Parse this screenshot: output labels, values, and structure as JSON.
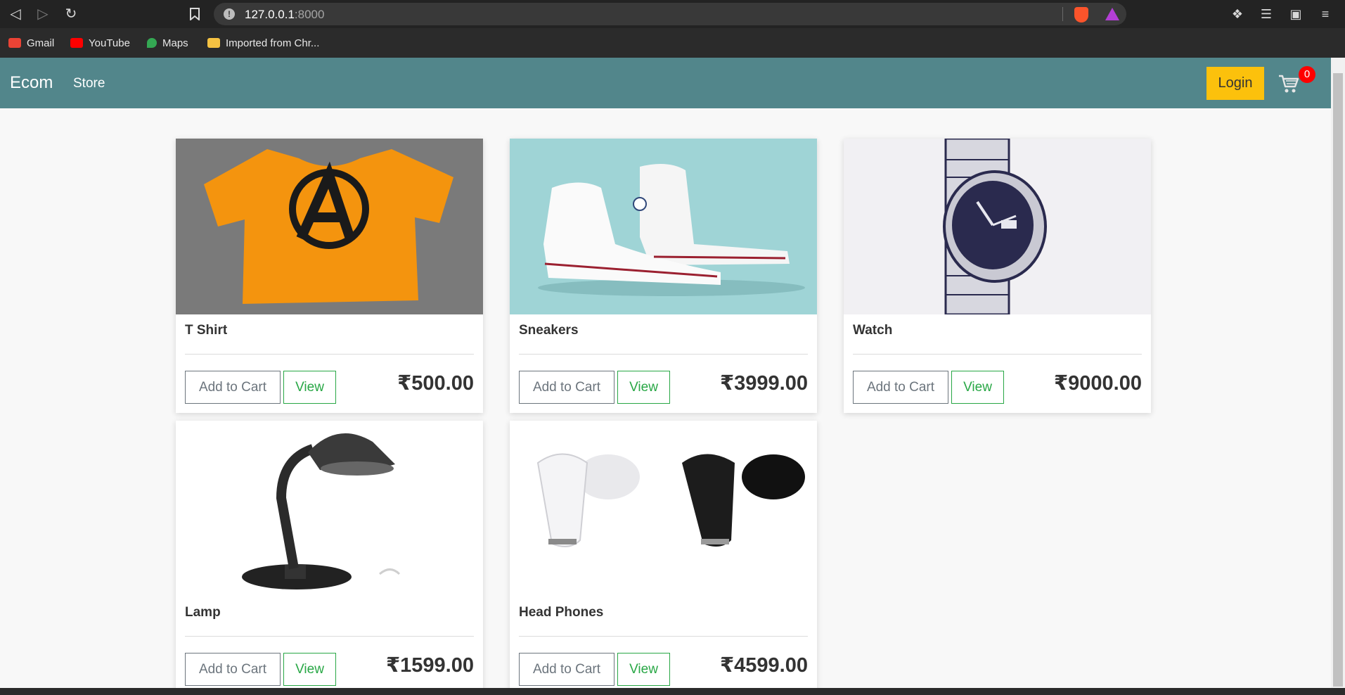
{
  "browser": {
    "url_host": "127.0.0.1",
    "url_port": ":8000",
    "bookmarks": [
      {
        "label": "Gmail",
        "color": "#ea4335"
      },
      {
        "label": "YouTube",
        "color": "#ff0000"
      },
      {
        "label": "Maps",
        "color": "#34a853"
      },
      {
        "label": "Imported from Chr...",
        "color": "#f5c242"
      }
    ]
  },
  "navbar": {
    "brand": "Ecom",
    "store_link": "Store",
    "login_label": "Login",
    "cart_count": "0"
  },
  "colors": {
    "navbar": "#52868b",
    "login": "#fcc10c",
    "view_button": "#28a745",
    "cart_badge": "#ff0000"
  },
  "products": [
    {
      "name": "T Shirt",
      "price": "₹500.00",
      "add_label": "Add to Cart",
      "view_label": "View",
      "image": "orange-tshirt"
    },
    {
      "name": "Sneakers",
      "price": "₹3999.00",
      "add_label": "Add to Cart",
      "view_label": "View",
      "image": "white-sneakers"
    },
    {
      "name": "Watch",
      "price": "₹9000.00",
      "add_label": "Add to Cart",
      "view_label": "View",
      "image": "wrist-watch"
    },
    {
      "name": "Lamp",
      "price": "₹1599.00",
      "add_label": "Add to Cart",
      "view_label": "View",
      "image": "desk-lamp"
    },
    {
      "name": "Head Phones",
      "price": "₹4599.00",
      "add_label": "Add to Cart",
      "view_label": "View",
      "image": "earbuds"
    }
  ]
}
